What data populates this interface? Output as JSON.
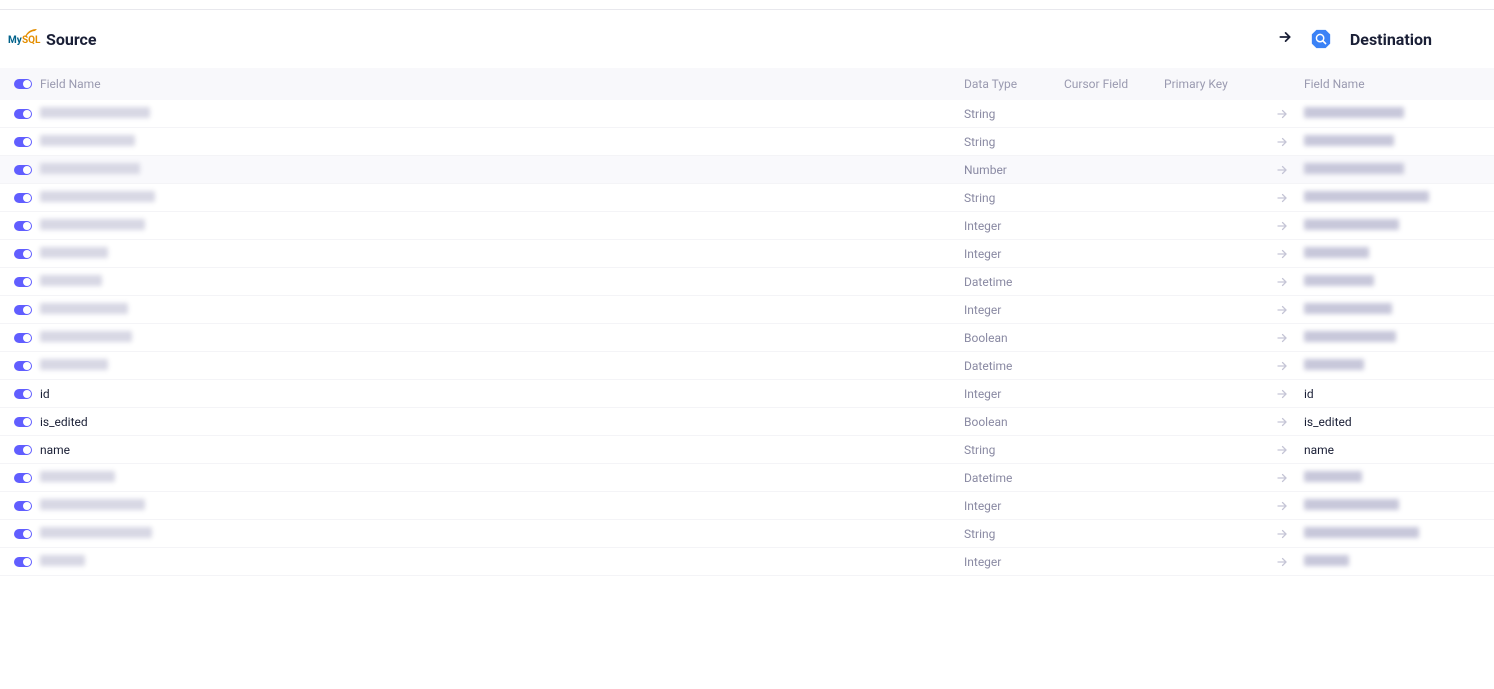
{
  "header": {
    "source_label": "Source",
    "destination_label": "Destination"
  },
  "columns": {
    "field_name": "Field Name",
    "data_type": "Data Type",
    "cursor_field": "Cursor Field",
    "primary_key": "Primary Key",
    "dest_field_name": "Field Name"
  },
  "rows": [
    {
      "source": null,
      "src_blur_w": 110,
      "data_type": "String",
      "dest": null,
      "dest_blur_w": 100,
      "highlight": false
    },
    {
      "source": null,
      "src_blur_w": 95,
      "data_type": "String",
      "dest": null,
      "dest_blur_w": 90,
      "highlight": false
    },
    {
      "source": null,
      "src_blur_w": 100,
      "data_type": "Number",
      "dest": null,
      "dest_blur_w": 100,
      "highlight": true
    },
    {
      "source": null,
      "src_blur_w": 115,
      "data_type": "String",
      "dest": null,
      "dest_blur_w": 125,
      "highlight": false
    },
    {
      "source": null,
      "src_blur_w": 105,
      "data_type": "Integer",
      "dest": null,
      "dest_blur_w": 95,
      "highlight": false
    },
    {
      "source": null,
      "src_blur_w": 68,
      "data_type": "Integer",
      "dest": null,
      "dest_blur_w": 65,
      "highlight": false
    },
    {
      "source": null,
      "src_blur_w": 62,
      "data_type": "Datetime",
      "dest": null,
      "dest_blur_w": 70,
      "highlight": false
    },
    {
      "source": null,
      "src_blur_w": 88,
      "data_type": "Integer",
      "dest": null,
      "dest_blur_w": 88,
      "highlight": false
    },
    {
      "source": null,
      "src_blur_w": 92,
      "data_type": "Boolean",
      "dest": null,
      "dest_blur_w": 92,
      "highlight": false
    },
    {
      "source": null,
      "src_blur_w": 68,
      "data_type": "Datetime",
      "dest": null,
      "dest_blur_w": 60,
      "highlight": false
    },
    {
      "source": "id",
      "src_blur_w": 0,
      "data_type": "Integer",
      "dest": "id",
      "dest_blur_w": 0,
      "highlight": false
    },
    {
      "source": "is_edited",
      "src_blur_w": 0,
      "data_type": "Boolean",
      "dest": "is_edited",
      "dest_blur_w": 0,
      "highlight": false
    },
    {
      "source": "name",
      "src_blur_w": 0,
      "data_type": "String",
      "dest": "name",
      "dest_blur_w": 0,
      "highlight": false
    },
    {
      "source": null,
      "src_blur_w": 75,
      "data_type": "Datetime",
      "dest": null,
      "dest_blur_w": 58,
      "highlight": false
    },
    {
      "source": null,
      "src_blur_w": 105,
      "data_type": "Integer",
      "dest": null,
      "dest_blur_w": 95,
      "highlight": false
    },
    {
      "source": null,
      "src_blur_w": 112,
      "data_type": "String",
      "dest": null,
      "dest_blur_w": 115,
      "highlight": false
    },
    {
      "source": null,
      "src_blur_w": 45,
      "data_type": "Integer",
      "dest": null,
      "dest_blur_w": 45,
      "highlight": false
    }
  ]
}
